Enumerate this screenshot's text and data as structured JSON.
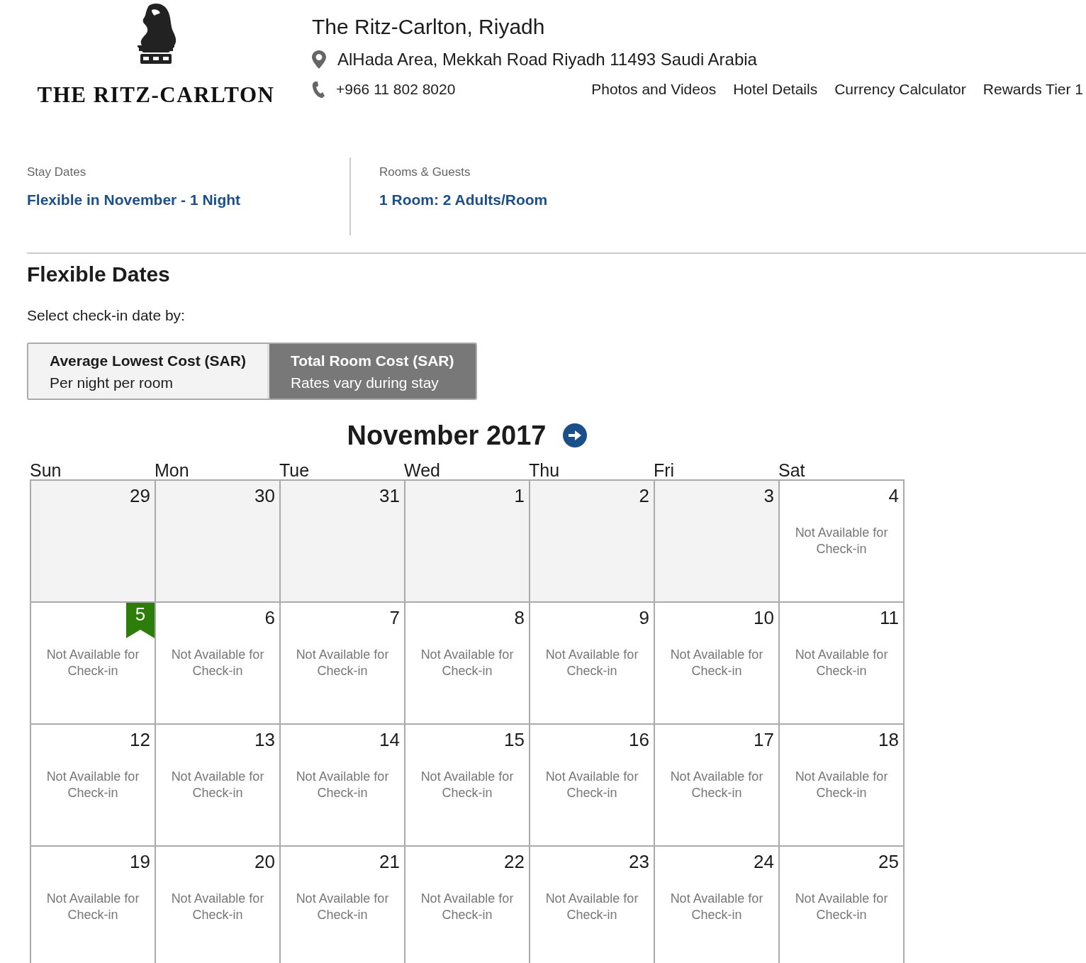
{
  "brand": {
    "wordmark": "THE RITZ-CARLTON"
  },
  "hotel": {
    "name": "The Ritz-Carlton, Riyadh",
    "address": "AlHada Area, Mekkah Road Riyadh 11493 Saudi Arabia",
    "phone": "+966 11 802 8020"
  },
  "nav": [
    "Photos and Videos",
    "Hotel Details",
    "Currency Calculator",
    "Rewards Tier 1"
  ],
  "summary": [
    {
      "label": "Stay Dates",
      "value": "Flexible in November - 1 Night"
    },
    {
      "label": "Rooms & Guests",
      "value": "1 Room: 2 Adults/Room"
    }
  ],
  "heading": "Flexible Dates",
  "prompt": "Select check-in date by:",
  "cost_options": [
    {
      "title": "Average Lowest Cost (SAR)",
      "subtitle": "Per night per room",
      "selected": false
    },
    {
      "title": "Total Room Cost (SAR)",
      "subtitle": "Rates vary during stay",
      "selected": true
    }
  ],
  "calendar": {
    "month": "November 2017",
    "weekdays": [
      "Sun",
      "Mon",
      "Tue",
      "Wed",
      "Thu",
      "Fri",
      "Sat"
    ],
    "weeks": [
      [
        {
          "day": "29",
          "outside": true
        },
        {
          "day": "30",
          "outside": true
        },
        {
          "day": "31",
          "outside": true
        },
        {
          "day": "1",
          "outside": true
        },
        {
          "day": "2",
          "outside": true
        },
        {
          "day": "3",
          "outside": true
        },
        {
          "day": "4",
          "outside": false,
          "status": "Not Available for Check-in"
        }
      ],
      [
        {
          "day": "5",
          "outside": false,
          "today": true,
          "status": "Not Available for Check-in"
        },
        {
          "day": "6",
          "outside": false,
          "status": "Not Available for Check-in"
        },
        {
          "day": "7",
          "outside": false,
          "status": "Not Available for Check-in"
        },
        {
          "day": "8",
          "outside": false,
          "status": "Not Available for Check-in"
        },
        {
          "day": "9",
          "outside": false,
          "status": "Not Available for Check-in"
        },
        {
          "day": "10",
          "outside": false,
          "status": "Not Available for Check-in"
        },
        {
          "day": "11",
          "outside": false,
          "status": "Not Available for Check-in"
        }
      ],
      [
        {
          "day": "12",
          "outside": false,
          "status": "Not Available for Check-in"
        },
        {
          "day": "13",
          "outside": false,
          "status": "Not Available for Check-in"
        },
        {
          "day": "14",
          "outside": false,
          "status": "Not Available for Check-in"
        },
        {
          "day": "15",
          "outside": false,
          "status": "Not Available for Check-in"
        },
        {
          "day": "16",
          "outside": false,
          "status": "Not Available for Check-in"
        },
        {
          "day": "17",
          "outside": false,
          "status": "Not Available for Check-in"
        },
        {
          "day": "18",
          "outside": false,
          "status": "Not Available for Check-in"
        }
      ],
      [
        {
          "day": "19",
          "outside": false,
          "status": "Not Available for Check-in"
        },
        {
          "day": "20",
          "outside": false,
          "status": "Not Available for Check-in"
        },
        {
          "day": "21",
          "outside": false,
          "status": "Not Available for Check-in"
        },
        {
          "day": "22",
          "outside": false,
          "status": "Not Available for Check-in"
        },
        {
          "day": "23",
          "outside": false,
          "status": "Not Available for Check-in"
        },
        {
          "day": "24",
          "outside": false,
          "status": "Not Available for Check-in"
        },
        {
          "day": "25",
          "outside": false,
          "status": "Not Available for Check-in"
        }
      ]
    ]
  }
}
